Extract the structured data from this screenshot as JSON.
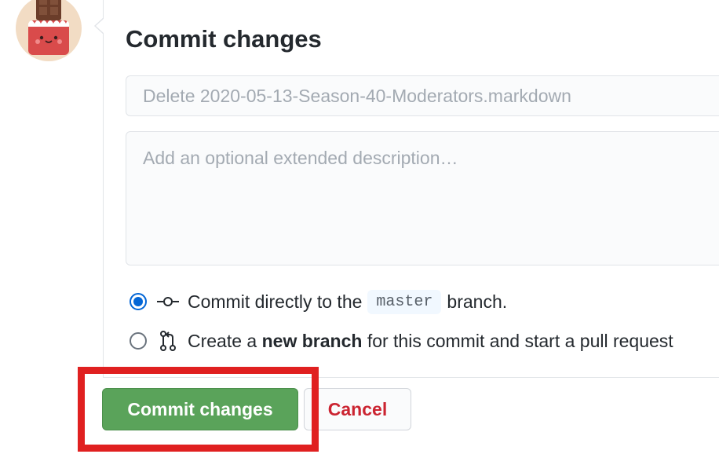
{
  "avatar": {
    "icon": "chocolate-bar-icon"
  },
  "form": {
    "title": "Commit changes",
    "summary": {
      "value": "",
      "placeholder": "Delete 2020-05-13-Season-40-Moderators.markdown"
    },
    "description": {
      "value": "",
      "placeholder": "Add an optional extended description…"
    }
  },
  "options": {
    "direct": {
      "selected": true,
      "icon": "git-commit-icon",
      "text_before": "Commit directly to the",
      "branch": "master",
      "text_after": "branch."
    },
    "new_branch": {
      "selected": false,
      "icon": "git-pull-request-icon",
      "text_before": "Create a",
      "bold": "new branch",
      "text_after": "for this commit and start a pull request"
    }
  },
  "buttons": {
    "commit": "Commit changes",
    "cancel": "Cancel"
  },
  "colors": {
    "commit_button": "#5aa35a",
    "cancel_text": "#cb2431",
    "radio_accent": "#0366d6",
    "highlight": "#e02020"
  }
}
